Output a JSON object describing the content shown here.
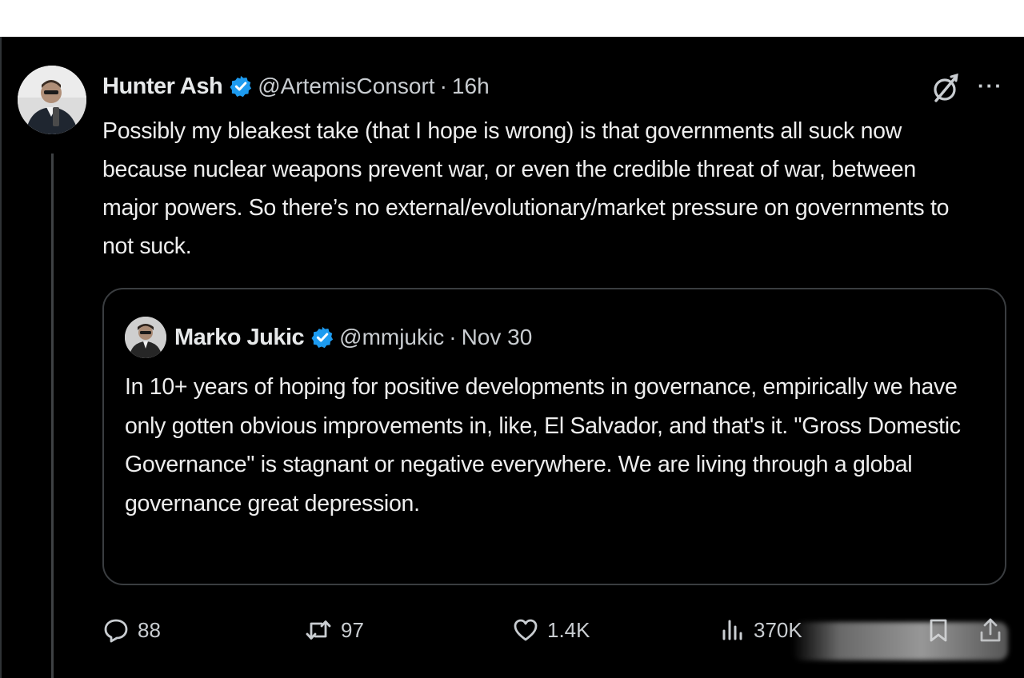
{
  "colors": {
    "background": "#000000",
    "text": "#e7e9ea",
    "secondary_text": "#c9cdd1",
    "verified_badge": "#1d9bf0",
    "card_border": "#3a3d40"
  },
  "tweet": {
    "author_name": "Hunter Ash",
    "author_handle": "@ArtemisConsort",
    "separator": "·",
    "time": "16h",
    "verified": true,
    "text": "Possibly my bleakest take (that I hope is wrong) is that governments all suck now because nuclear weapons prevent war, or even the credible threat of war, between major powers. So there’s no external/evolutionary/market pressure on governments to not suck.",
    "icons": {
      "grok": "grok-icon",
      "more": "more-options-icon",
      "more_glyph": "···"
    }
  },
  "quoted_tweet": {
    "author_name": "Marko Jukic",
    "author_handle": "@mmjukic",
    "separator": "·",
    "date": "Nov 30",
    "verified": true,
    "text": "In 10+ years of hoping for positive developments in governance, empirically we have only gotten obvious improvements in, like, El Salvador, and that's it. \"Gross Domestic Governance\" is stagnant or negative everywhere. We are living through a global governance great depression."
  },
  "actions": {
    "replies": "88",
    "reposts": "97",
    "likes": "1.4K",
    "views": "370K",
    "icons": [
      "reply-icon",
      "repost-icon",
      "like-icon",
      "views-icon",
      "bookmark-icon",
      "share-icon"
    ]
  }
}
